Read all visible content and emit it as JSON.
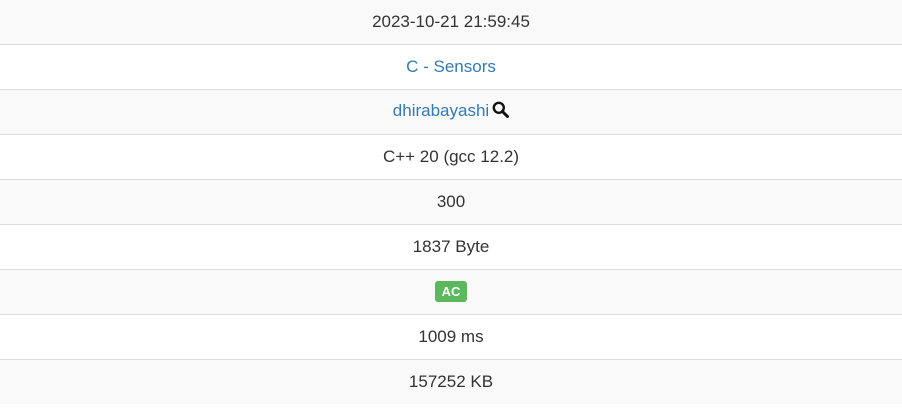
{
  "submission": {
    "submission_time": "2023-10-21 21:59:45",
    "task": "C - Sensors",
    "user": "dhirabayashi",
    "language": "C++ 20 (gcc 12.2)",
    "score": "300",
    "code_size": "1837 Byte",
    "status": "AC",
    "exec_time": "1009 ms",
    "memory": "157252 KB"
  },
  "icons": {
    "user_search": "search-icon"
  },
  "colors": {
    "link": "#337ab7",
    "status_ac": "#5cb85c",
    "row_alt": "#f9f9f9",
    "border": "#dddddd",
    "text": "#333333"
  }
}
